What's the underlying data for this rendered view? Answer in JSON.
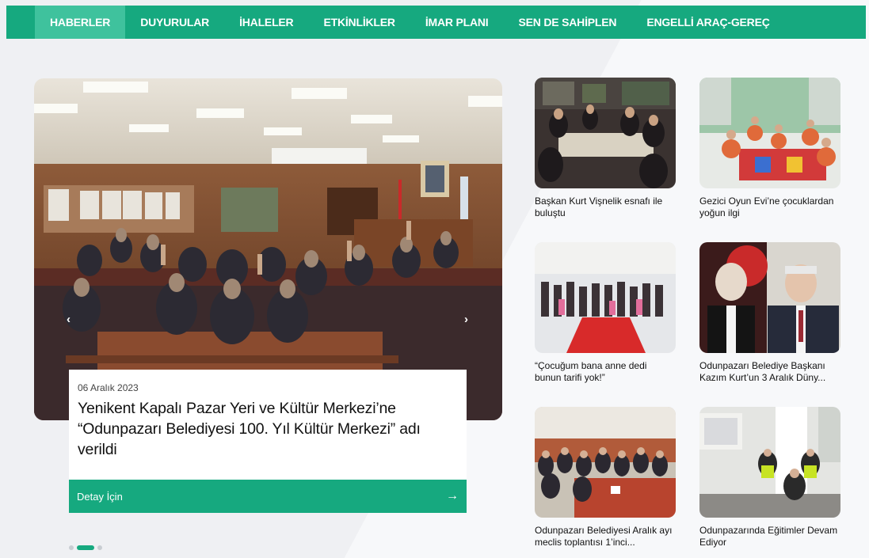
{
  "nav": {
    "items": [
      {
        "label": "HABERLER",
        "active": true
      },
      {
        "label": "DUYURULAR",
        "active": false
      },
      {
        "label": "İHALELER",
        "active": false
      },
      {
        "label": "ETKİNLİKLER",
        "active": false
      },
      {
        "label": "İMAR PLANI",
        "active": false
      },
      {
        "label": "SEN DE SAHİPLEN",
        "active": false
      },
      {
        "label": "ENGELLİ ARAÇ-GEREÇ",
        "active": false
      }
    ]
  },
  "hero": {
    "date": "06 Aralık 2023",
    "title": "Yenikent Kapalı Pazar Yeri ve Kültür Merkezi’ne “Odunpazarı Belediyesi 100. Yıl Kültür Merkezi” adı verildi",
    "detail_label": "Detay İçin",
    "prev_icon": "chevron-left-icon",
    "next_icon": "chevron-right-icon",
    "detail_icon": "arrow-right-icon",
    "slide_count": 3,
    "active_slide": 2
  },
  "cards": [
    {
      "title": "Başkan Kurt Vişnelik esnafı ile buluştu"
    },
    {
      "title": "Gezici Oyun Evi’ne çocuklardan yoğun ilgi"
    },
    {
      "title": "“Çocuğum bana anne dedi bunun tarifi yok!”"
    },
    {
      "title": "Odunpazarı Belediye Başkanı Kazım Kurt’un 3 Aralık Düny..."
    },
    {
      "title": "Odunpazarı Belediyesi Aralık ayı meclis toplantısı 1’inci..."
    },
    {
      "title": "Odunpazarında Eğitimler Devam Ediyor"
    }
  ],
  "colors": {
    "brand_green": "#16a97f",
    "nav_active": "#3fc29d",
    "background": "#f4f5f7"
  }
}
